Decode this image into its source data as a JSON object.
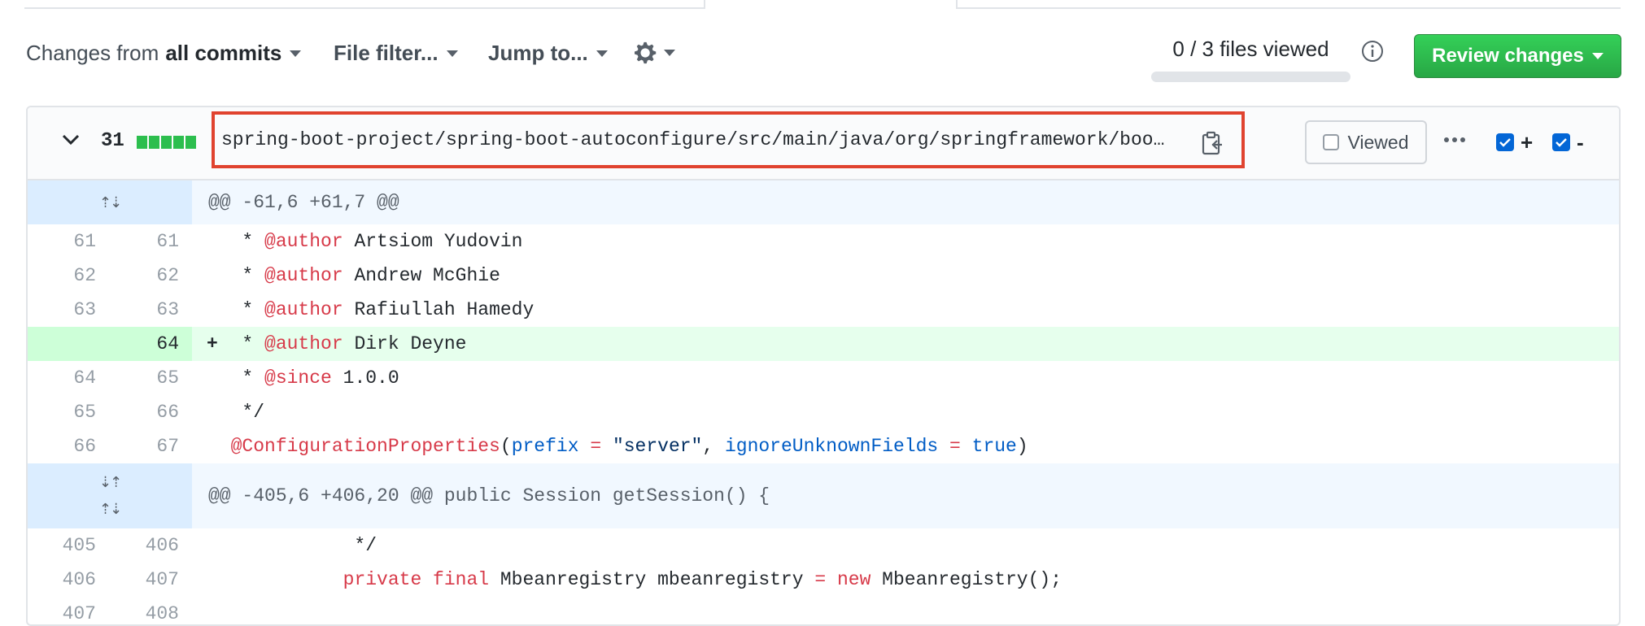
{
  "toolbar": {
    "changes_prefix": "Changes from",
    "changes_value": "all commits",
    "file_filter": "File filter...",
    "jump_to": "Jump to...",
    "files_viewed_text": "0 / 3 files viewed",
    "files_viewed_progress": 0,
    "review_button": "Review changes"
  },
  "file": {
    "line_count": "31",
    "path": "spring-boot-project/spring-boot-autoconfigure/src/main/java/org/springframework/boot/autoconfigure/web/ServerProperties.java",
    "viewed_label": "Viewed",
    "plus_symbol": "+",
    "minus_symbol": "-"
  },
  "hunks": [
    {
      "header": "@@ -61,6 +61,7 @@"
    },
    {
      "header": "@@ -405,6 +406,20 @@ public Session getSession() {"
    }
  ],
  "lines": [
    {
      "old": "61",
      "new": "61",
      "marker": "",
      "pre": "   * ",
      "kw": "@author",
      "rest": " Artsiom Yudovin"
    },
    {
      "old": "62",
      "new": "62",
      "marker": "",
      "pre": "   * ",
      "kw": "@author",
      "rest": " Andrew McGhie"
    },
    {
      "old": "63",
      "new": "63",
      "marker": "",
      "pre": "   * ",
      "kw": "@author",
      "rest": " Rafiullah Hamedy"
    },
    {
      "old": "",
      "new": "64",
      "marker": "+",
      "pre": "   * ",
      "kw": "@author",
      "rest": " Dirk Deyne"
    },
    {
      "old": "64",
      "new": "65",
      "marker": "",
      "pre": "   * ",
      "kw": "@since",
      "rest": " 1.0.0"
    },
    {
      "old": "65",
      "new": "66",
      "marker": "",
      "pre": "   */",
      "kw": "",
      "rest": ""
    },
    {
      "old": "66",
      "new": "67",
      "annotation": "@ConfigurationProperties",
      "p_open": "(",
      "prefix": "prefix",
      "eq1": " = ",
      "str": "\"server\"",
      "comma": ", ",
      "ignore": "ignoreUnknownFields",
      "eq2": " = ",
      "tru": "true",
      "p_close": ")"
    },
    {
      "old": "405",
      "new": "406",
      "marker": "",
      "pre": "             */",
      "kw": "",
      "rest": ""
    },
    {
      "old": "406",
      "new": "407",
      "indent": "            ",
      "k1": "private final",
      "type1": " Mbeanregistry mbeanregistry ",
      "eq": "=",
      "k2": " new",
      "rest2": " Mbeanregistry();"
    },
    {
      "old": "407",
      "new": "408",
      "marker": "",
      "pre": "",
      "kw": "",
      "rest": ""
    }
  ],
  "colors": {
    "accent_green": "#28a745",
    "highlight_red": "#e0432f",
    "add_bg": "#e6ffed",
    "hunk_bg": "#f1f8ff"
  }
}
